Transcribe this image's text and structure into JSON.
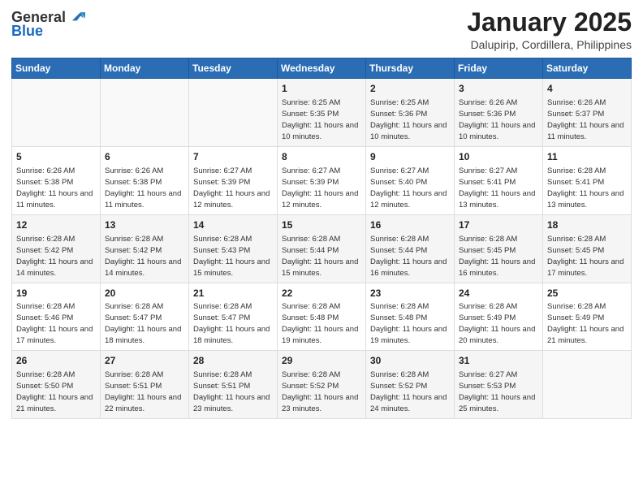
{
  "logo": {
    "general": "General",
    "blue": "Blue"
  },
  "header": {
    "month": "January 2025",
    "location": "Dalupirip, Cordillera, Philippines"
  },
  "weekdays": [
    "Sunday",
    "Monday",
    "Tuesday",
    "Wednesday",
    "Thursday",
    "Friday",
    "Saturday"
  ],
  "weeks": [
    [
      {
        "day": "",
        "sunrise": "",
        "sunset": "",
        "daylight": ""
      },
      {
        "day": "",
        "sunrise": "",
        "sunset": "",
        "daylight": ""
      },
      {
        "day": "",
        "sunrise": "",
        "sunset": "",
        "daylight": ""
      },
      {
        "day": "1",
        "sunrise": "Sunrise: 6:25 AM",
        "sunset": "Sunset: 5:35 PM",
        "daylight": "Daylight: 11 hours and 10 minutes."
      },
      {
        "day": "2",
        "sunrise": "Sunrise: 6:25 AM",
        "sunset": "Sunset: 5:36 PM",
        "daylight": "Daylight: 11 hours and 10 minutes."
      },
      {
        "day": "3",
        "sunrise": "Sunrise: 6:26 AM",
        "sunset": "Sunset: 5:36 PM",
        "daylight": "Daylight: 11 hours and 10 minutes."
      },
      {
        "day": "4",
        "sunrise": "Sunrise: 6:26 AM",
        "sunset": "Sunset: 5:37 PM",
        "daylight": "Daylight: 11 hours and 11 minutes."
      }
    ],
    [
      {
        "day": "5",
        "sunrise": "Sunrise: 6:26 AM",
        "sunset": "Sunset: 5:38 PM",
        "daylight": "Daylight: 11 hours and 11 minutes."
      },
      {
        "day": "6",
        "sunrise": "Sunrise: 6:26 AM",
        "sunset": "Sunset: 5:38 PM",
        "daylight": "Daylight: 11 hours and 11 minutes."
      },
      {
        "day": "7",
        "sunrise": "Sunrise: 6:27 AM",
        "sunset": "Sunset: 5:39 PM",
        "daylight": "Daylight: 11 hours and 12 minutes."
      },
      {
        "day": "8",
        "sunrise": "Sunrise: 6:27 AM",
        "sunset": "Sunset: 5:39 PM",
        "daylight": "Daylight: 11 hours and 12 minutes."
      },
      {
        "day": "9",
        "sunrise": "Sunrise: 6:27 AM",
        "sunset": "Sunset: 5:40 PM",
        "daylight": "Daylight: 11 hours and 12 minutes."
      },
      {
        "day": "10",
        "sunrise": "Sunrise: 6:27 AM",
        "sunset": "Sunset: 5:41 PM",
        "daylight": "Daylight: 11 hours and 13 minutes."
      },
      {
        "day": "11",
        "sunrise": "Sunrise: 6:28 AM",
        "sunset": "Sunset: 5:41 PM",
        "daylight": "Daylight: 11 hours and 13 minutes."
      }
    ],
    [
      {
        "day": "12",
        "sunrise": "Sunrise: 6:28 AM",
        "sunset": "Sunset: 5:42 PM",
        "daylight": "Daylight: 11 hours and 14 minutes."
      },
      {
        "day": "13",
        "sunrise": "Sunrise: 6:28 AM",
        "sunset": "Sunset: 5:42 PM",
        "daylight": "Daylight: 11 hours and 14 minutes."
      },
      {
        "day": "14",
        "sunrise": "Sunrise: 6:28 AM",
        "sunset": "Sunset: 5:43 PM",
        "daylight": "Daylight: 11 hours and 15 minutes."
      },
      {
        "day": "15",
        "sunrise": "Sunrise: 6:28 AM",
        "sunset": "Sunset: 5:44 PM",
        "daylight": "Daylight: 11 hours and 15 minutes."
      },
      {
        "day": "16",
        "sunrise": "Sunrise: 6:28 AM",
        "sunset": "Sunset: 5:44 PM",
        "daylight": "Daylight: 11 hours and 16 minutes."
      },
      {
        "day": "17",
        "sunrise": "Sunrise: 6:28 AM",
        "sunset": "Sunset: 5:45 PM",
        "daylight": "Daylight: 11 hours and 16 minutes."
      },
      {
        "day": "18",
        "sunrise": "Sunrise: 6:28 AM",
        "sunset": "Sunset: 5:45 PM",
        "daylight": "Daylight: 11 hours and 17 minutes."
      }
    ],
    [
      {
        "day": "19",
        "sunrise": "Sunrise: 6:28 AM",
        "sunset": "Sunset: 5:46 PM",
        "daylight": "Daylight: 11 hours and 17 minutes."
      },
      {
        "day": "20",
        "sunrise": "Sunrise: 6:28 AM",
        "sunset": "Sunset: 5:47 PM",
        "daylight": "Daylight: 11 hours and 18 minutes."
      },
      {
        "day": "21",
        "sunrise": "Sunrise: 6:28 AM",
        "sunset": "Sunset: 5:47 PM",
        "daylight": "Daylight: 11 hours and 18 minutes."
      },
      {
        "day": "22",
        "sunrise": "Sunrise: 6:28 AM",
        "sunset": "Sunset: 5:48 PM",
        "daylight": "Daylight: 11 hours and 19 minutes."
      },
      {
        "day": "23",
        "sunrise": "Sunrise: 6:28 AM",
        "sunset": "Sunset: 5:48 PM",
        "daylight": "Daylight: 11 hours and 19 minutes."
      },
      {
        "day": "24",
        "sunrise": "Sunrise: 6:28 AM",
        "sunset": "Sunset: 5:49 PM",
        "daylight": "Daylight: 11 hours and 20 minutes."
      },
      {
        "day": "25",
        "sunrise": "Sunrise: 6:28 AM",
        "sunset": "Sunset: 5:49 PM",
        "daylight": "Daylight: 11 hours and 21 minutes."
      }
    ],
    [
      {
        "day": "26",
        "sunrise": "Sunrise: 6:28 AM",
        "sunset": "Sunset: 5:50 PM",
        "daylight": "Daylight: 11 hours and 21 minutes."
      },
      {
        "day": "27",
        "sunrise": "Sunrise: 6:28 AM",
        "sunset": "Sunset: 5:51 PM",
        "daylight": "Daylight: 11 hours and 22 minutes."
      },
      {
        "day": "28",
        "sunrise": "Sunrise: 6:28 AM",
        "sunset": "Sunset: 5:51 PM",
        "daylight": "Daylight: 11 hours and 23 minutes."
      },
      {
        "day": "29",
        "sunrise": "Sunrise: 6:28 AM",
        "sunset": "Sunset: 5:52 PM",
        "daylight": "Daylight: 11 hours and 23 minutes."
      },
      {
        "day": "30",
        "sunrise": "Sunrise: 6:28 AM",
        "sunset": "Sunset: 5:52 PM",
        "daylight": "Daylight: 11 hours and 24 minutes."
      },
      {
        "day": "31",
        "sunrise": "Sunrise: 6:27 AM",
        "sunset": "Sunset: 5:53 PM",
        "daylight": "Daylight: 11 hours and 25 minutes."
      },
      {
        "day": "",
        "sunrise": "",
        "sunset": "",
        "daylight": ""
      }
    ]
  ]
}
